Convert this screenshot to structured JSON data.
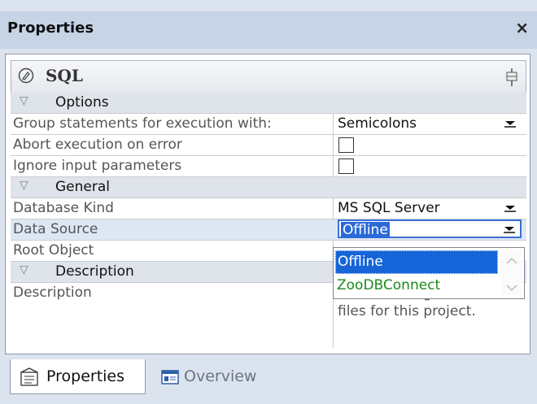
{
  "panel_title": "Properties",
  "close_glyph": "×",
  "header": {
    "title": "SQL",
    "icon": "sql-file-icon",
    "pin_icon": "pin-icon"
  },
  "sections": {
    "options": "Options",
    "general": "General",
    "description": "Description"
  },
  "options": {
    "group_label": "Group statements for execution with:",
    "group_value": "Semicolons",
    "abort_label": "Abort execution on error",
    "abort_checked": false,
    "ignore_label": "Ignore input parameters",
    "ignore_checked": false
  },
  "general": {
    "dbkind_label": "Database Kind",
    "dbkind_value": "MS SQL Server",
    "datasource_label": "Data Source",
    "datasource_value": "Offline",
    "root_label": "Root Object"
  },
  "datasource_options": [
    "Offline",
    "ZooDBConnect"
  ],
  "description": {
    "label": "Description",
    "value": "Store and organize SQL files for this project."
  },
  "tabs": [
    {
      "label": "Properties",
      "icon": "properties-icon",
      "active": true
    },
    {
      "label": "Overview",
      "icon": "overview-icon",
      "active": false
    }
  ],
  "colors": {
    "title_bar": "#c6d4e6",
    "selection": "#1565d8",
    "option_green": "#1a8a1a"
  }
}
